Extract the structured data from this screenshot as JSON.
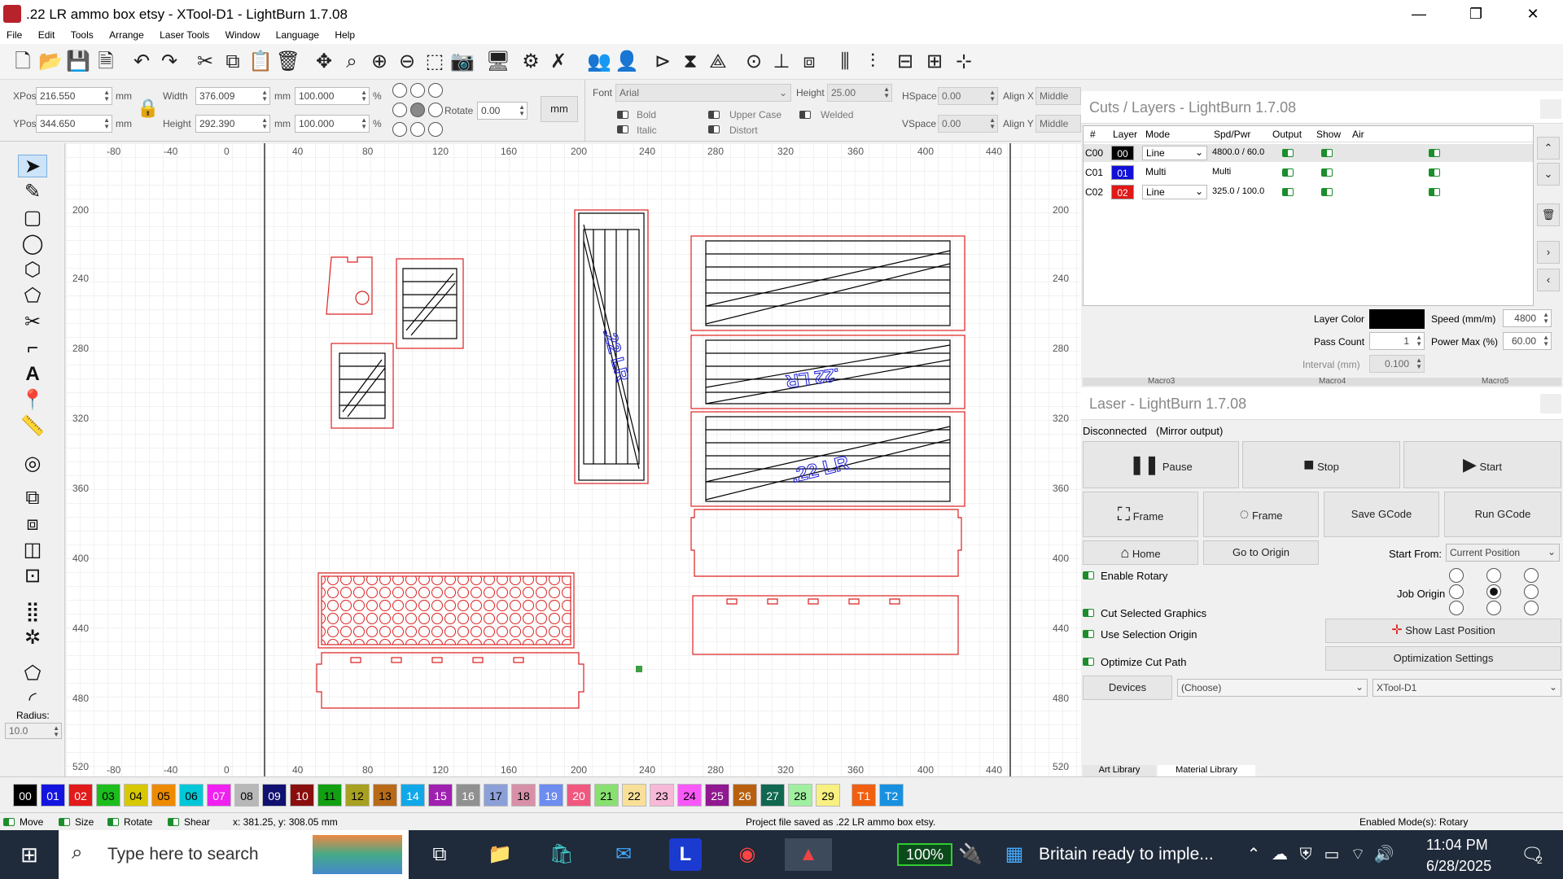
{
  "window": {
    "title": ".22 LR ammo box etsy - XTool-D1 - LightBurn 1.7.08",
    "minimize": "—",
    "restore": "❐",
    "close": "✕"
  },
  "menu": [
    "File",
    "Edit",
    "Tools",
    "Arrange",
    "Laser Tools",
    "Window",
    "Language",
    "Help"
  ],
  "props": {
    "xpos_label": "XPos",
    "xpos": "216.550",
    "ypos_label": "YPos",
    "ypos": "344.650",
    "unit": "mm",
    "width_label": "Width",
    "width": "376.009",
    "height_label": "Height",
    "height": "292.390",
    "wpct": "100.000",
    "hpct": "100.000",
    "pct": "%",
    "rotate_label": "Rotate",
    "rotate": "0.00",
    "mm_button": "mm",
    "font_label": "Font",
    "font": "Arial",
    "fheight_label": "Height",
    "fheight": "25.00",
    "hspace_label": "HSpace",
    "hspace": "0.00",
    "vspace_label": "VSpace",
    "vspace": "0.00",
    "alignx_label": "Align X",
    "alignx": "Middle",
    "aligny_label": "Align Y",
    "aligny": "Middle",
    "bold": "Bold",
    "italic": "Italic",
    "upper": "Upper Case",
    "distort": "Distort",
    "welded": "Welded"
  },
  "ruler": {
    "x": [
      "-80",
      "-40",
      "0",
      "40",
      "80",
      "120",
      "160",
      "200",
      "240",
      "280",
      "320",
      "360",
      "400",
      "440"
    ],
    "y": [
      "200",
      "240",
      "280",
      "320",
      "360",
      "400",
      "440",
      "480",
      "520"
    ]
  },
  "canvas_text": {
    "lr1": ".22 LR",
    "lr2": ".22 LR",
    "lr3": ".22 LR"
  },
  "radius": {
    "label": "Radius:",
    "value": "10.0"
  },
  "cuts": {
    "title": "Cuts / Layers - LightBurn 1.7.08",
    "headers": [
      "#",
      "Layer",
      "Mode",
      "Spd/Pwr",
      "Output",
      "Show",
      "Air"
    ],
    "rows": [
      {
        "id": "C00",
        "layer": "00",
        "color": "#000000",
        "mode": "Line",
        "spd": "4800.0 / 60.0"
      },
      {
        "id": "C01",
        "layer": "01",
        "color": "#1010d8",
        "mode": "Multi",
        "spd": "Multi"
      },
      {
        "id": "C02",
        "layer": "02",
        "color": "#e01818",
        "mode": "Line",
        "spd": "325.0 / 100.0"
      }
    ],
    "layer_color": "Layer Color",
    "speed_label": "Speed (mm/m)",
    "speed": "4800",
    "pass_label": "Pass Count",
    "pass": "1",
    "power_label": "Power Max (%)",
    "power": "60.00",
    "interval_label": "Interval (mm)",
    "interval": "0.100",
    "macros": [
      "Macro3",
      "Macro4",
      "Macro5"
    ]
  },
  "laser": {
    "title": "Laser - LightBurn 1.7.08",
    "status": "Disconnected",
    "mirror": "(Mirror output)",
    "pause": "Pause",
    "stop": "Stop",
    "start": "Start",
    "frame1": "Frame",
    "frame2": "Frame",
    "save_gcode": "Save GCode",
    "run_gcode": "Run GCode",
    "home": "Home",
    "go_origin": "Go to Origin",
    "start_from_label": "Start From:",
    "start_from": "Current Position",
    "enable_rotary": "Enable Rotary",
    "job_origin": "Job Origin",
    "cut_selected": "Cut Selected Graphics",
    "use_selection": "Use Selection Origin",
    "show_last": "Show Last Position",
    "optimize": "Optimize Cut Path",
    "opt_settings": "Optimization Settings",
    "devices": "Devices",
    "choose": "(Choose)",
    "device": "XTool-D1",
    "tabs": [
      "Art Library",
      "Material Library"
    ]
  },
  "palette": [
    {
      "n": "00",
      "c": "#000000",
      "t": "#fff"
    },
    {
      "n": "01",
      "c": "#1414e0",
      "t": "#fff"
    },
    {
      "n": "02",
      "c": "#e21a1a",
      "t": "#fff"
    },
    {
      "n": "03",
      "c": "#1cbd1c",
      "t": "#000"
    },
    {
      "n": "04",
      "c": "#d8c800",
      "t": "#000"
    },
    {
      "n": "05",
      "c": "#ee8a00",
      "t": "#000"
    },
    {
      "n": "06",
      "c": "#00c8d8",
      "t": "#000"
    },
    {
      "n": "07",
      "c": "#f020f0",
      "t": "#fff"
    },
    {
      "n": "08",
      "c": "#b8b8b8",
      "t": "#000"
    },
    {
      "n": "09",
      "c": "#101070",
      "t": "#fff"
    },
    {
      "n": "10",
      "c": "#8a0e0e",
      "t": "#fff"
    },
    {
      "n": "11",
      "c": "#12a012",
      "t": "#000"
    },
    {
      "n": "12",
      "c": "#a8a020",
      "t": "#000"
    },
    {
      "n": "13",
      "c": "#b86a18",
      "t": "#000"
    },
    {
      "n": "14",
      "c": "#10a8e8",
      "t": "#fff"
    },
    {
      "n": "15",
      "c": "#a020b0",
      "t": "#fff"
    },
    {
      "n": "16",
      "c": "#909090",
      "t": "#fff"
    },
    {
      "n": "17",
      "c": "#8ca0d8",
      "t": "#000"
    },
    {
      "n": "18",
      "c": "#d890a8",
      "t": "#000"
    },
    {
      "n": "19",
      "c": "#6c8cf0",
      "t": "#fff"
    },
    {
      "n": "20",
      "c": "#f05880",
      "t": "#fff"
    },
    {
      "n": "21",
      "c": "#88e070",
      "t": "#000"
    },
    {
      "n": "22",
      "c": "#f8e098",
      "t": "#000"
    },
    {
      "n": "23",
      "c": "#f8b8d8",
      "t": "#000"
    },
    {
      "n": "24",
      "c": "#f858f8",
      "t": "#000"
    },
    {
      "n": "25",
      "c": "#901890",
      "t": "#fff"
    },
    {
      "n": "26",
      "c": "#b86010",
      "t": "#fff"
    },
    {
      "n": "27",
      "c": "#106850",
      "t": "#fff"
    },
    {
      "n": "28",
      "c": "#a0f0a0",
      "t": "#000"
    },
    {
      "n": "29",
      "c": "#f8f080",
      "t": "#000"
    },
    {
      "n": "T1",
      "c": "#f06010",
      "t": "#fff"
    },
    {
      "n": "T2",
      "c": "#1890e0",
      "t": "#fff"
    }
  ],
  "status": {
    "move": "Move",
    "size": "Size",
    "rotate": "Rotate",
    "shear": "Shear",
    "coords": "x: 381.25, y: 308.05 mm",
    "message": "Project file saved as .22 LR ammo box etsy.",
    "modes": "Enabled Mode(s): Rotary"
  },
  "taskbar": {
    "search": "Type here to search",
    "battery": "100%",
    "news": "Britain ready to imple...",
    "time": "11:04 PM",
    "date": "6/28/2025",
    "notif": "2"
  }
}
